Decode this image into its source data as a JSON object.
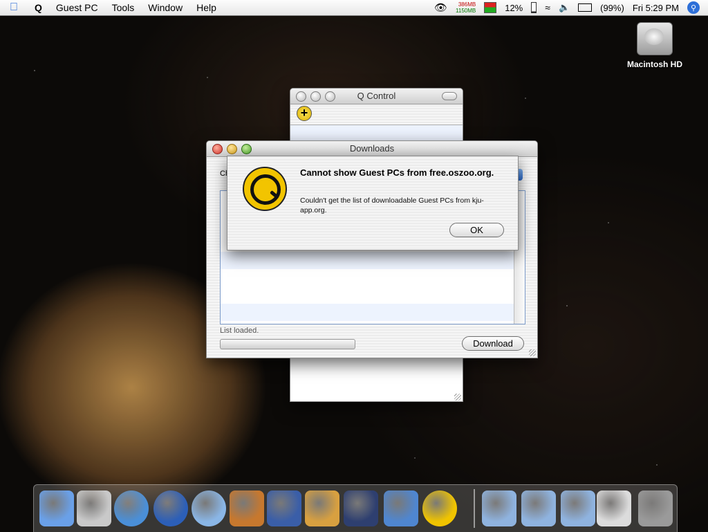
{
  "menubar": {
    "app_name": "Guest PC",
    "menus": [
      "Tools",
      "Window",
      "Help"
    ],
    "memory_top": "386MB",
    "memory_bottom": "1150MB",
    "cpu": "12%",
    "battery": "(99%)",
    "clock": "Fri 5:29 PM"
  },
  "desktop": {
    "hd_label": "Macintosh HD"
  },
  "q_control": {
    "title": "Q Control"
  },
  "downloads": {
    "title": "Downloads",
    "choose_label": "Choo",
    "status": "List loaded.",
    "progress": 0,
    "download_button": "Download"
  },
  "alert": {
    "heading": "Cannot show Guest PCs from free.oszoo.org.",
    "message": "Couldn't get the list of downloadable Guest PCs from kju-app.org.",
    "ok_button": "OK"
  },
  "dock": {
    "items": [
      {
        "name": "finder-icon",
        "color": "#6aa0e8"
      },
      {
        "name": "system-preferences-icon",
        "color": "#c9c9c9"
      },
      {
        "name": "safari-icon",
        "color": "#4a8fd8"
      },
      {
        "name": "network-globe-icon",
        "color": "#2c5fb8"
      },
      {
        "name": "itunes-icon",
        "color": "#8ab6e6"
      },
      {
        "name": "garageband-icon",
        "color": "#c7782e"
      },
      {
        "name": "imovie-icon",
        "color": "#3a5ea8"
      },
      {
        "name": "iphoto-icon",
        "color": "#d8a040"
      },
      {
        "name": "c-app-icon",
        "color": "#2e3f70"
      },
      {
        "name": "openoffice-icon",
        "color": "#4f86d0"
      },
      {
        "name": "q-app-icon",
        "color": "#f0c400"
      },
      {
        "name": "documents-folder-icon",
        "color": "#8fb3df"
      },
      {
        "name": "folder-icon",
        "color": "#8fb3df"
      },
      {
        "name": "applications-folder-icon",
        "color": "#8fb3df"
      },
      {
        "name": "window-preview-icon",
        "color": "#dcdcdc"
      },
      {
        "name": "trash-icon",
        "color": "#9a9a9a"
      }
    ]
  }
}
